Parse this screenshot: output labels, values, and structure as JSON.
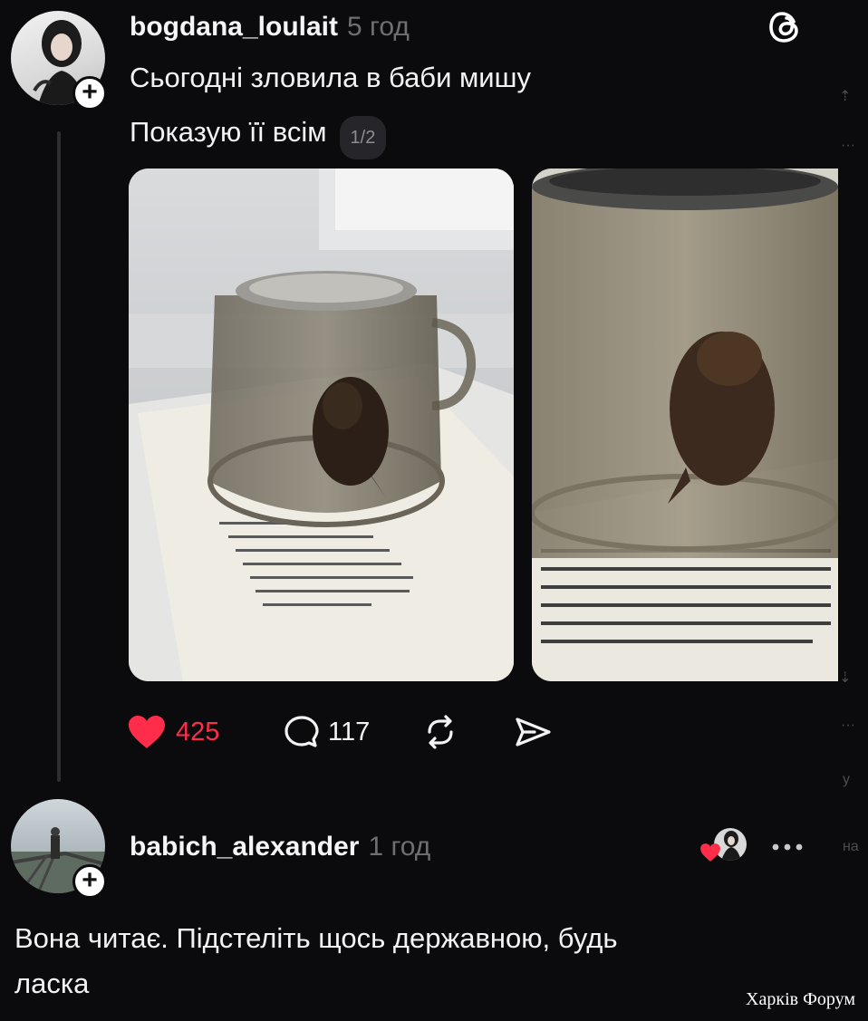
{
  "post": {
    "username": "bogdana_loulait",
    "time": "5 год",
    "line1": "Сьогодні зловила в баби мишу",
    "line2": "Показую її всім",
    "image_counter": "1/2",
    "likes": "425",
    "comments": "117",
    "images": [
      "photo-1-mouse-under-glass-cup",
      "photo-2-mouse-closeup"
    ]
  },
  "reply": {
    "username": "babich_alexander",
    "time": "1 год",
    "text_line1": "Вона читає. Підстеліть щось державною, будь",
    "text_line2": "ласка"
  },
  "side_peek": [
    "у",
    "на"
  ],
  "watermark": "Харків Форум",
  "colors": {
    "background": "#0b0a0c",
    "like_red": "#ff2d49",
    "muted": "#6f6f73",
    "text": "#f3f3f3"
  },
  "icons": [
    "threads-logo-icon",
    "plus-icon",
    "heart-icon",
    "comment-icon",
    "repost-icon",
    "share-icon",
    "more-icon"
  ]
}
